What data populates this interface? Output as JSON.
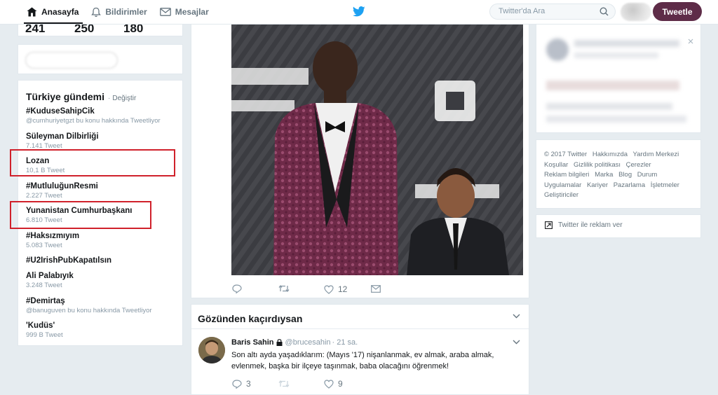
{
  "nav": {
    "home": "Anasayfa",
    "notifications": "Bildirimler",
    "messages": "Mesajlar",
    "home_icon": "home-icon",
    "notifications_icon": "bell-icon",
    "messages_icon": "envelope-icon"
  },
  "search": {
    "placeholder": "Twitter'da Ara"
  },
  "tweet_button": "Tweetle",
  "colors": {
    "accent": "#5e2c48",
    "twitter_blue": "#1da1f2",
    "highlight": "#d0212b",
    "background": "#e6ecf0"
  },
  "profile_stats": [
    "241",
    "250",
    "180"
  ],
  "trends": {
    "title": "Türkiye gündemi",
    "separator": "·",
    "change": "Değiştir",
    "items": [
      {
        "name": "#KuduseSahipCik",
        "meta": "@cumhuriyetgzt bu konu hakkında Tweetliyor"
      },
      {
        "name": "Süleyman Dilbirliği",
        "meta": "7.141 Tweet"
      },
      {
        "name": "Lozan",
        "meta": "10,1 B Tweet"
      },
      {
        "name": "#MutluluğunResmi",
        "meta": "2.227 Tweet"
      },
      {
        "name": "Yunanistan Cumhurbaşkanı",
        "meta": "6.810 Tweet"
      },
      {
        "name": "#Haksızmıyım",
        "meta": "5.083 Tweet"
      },
      {
        "name": "#U2IrishPubKapatılsın",
        "meta": ""
      },
      {
        "name": "Ali Palabıyık",
        "meta": "3.248 Tweet"
      },
      {
        "name": "#Demirtaş",
        "meta": "@banuguven bu konu hakkında Tweetliyor"
      },
      {
        "name": "'Kudüs'",
        "meta": "999 B Tweet"
      }
    ]
  },
  "photo_tweet": {
    "like_count": "12"
  },
  "missed": {
    "title": "Gözünden kaçırdıysan",
    "tweet": {
      "name": "Baris Sahin",
      "handle": "@brucesahin",
      "time": "· 21 sa.",
      "text": "Son altı ayda yaşadıklarım: (Mayıs '17) nişanlanmak, ev almak, araba almak, evlenmek, başka bir ilçeye taşınmak, baba olacağını öğrenmek!",
      "reply_count": "3",
      "like_count": "9"
    }
  },
  "footer": {
    "links": [
      "© 2017 Twitter",
      "Hakkımızda",
      "Yardım Merkezi",
      "Koşullar",
      "Gizlilik politikası",
      "Çerezler",
      "Reklam bilgileri",
      "Marka",
      "Blog",
      "Durum",
      "Uygulamalar",
      "Kariyer",
      "Pazarlama",
      "İşletmeler",
      "Geliştiriciler"
    ]
  },
  "ads_link": "Twitter ile reklam ver"
}
